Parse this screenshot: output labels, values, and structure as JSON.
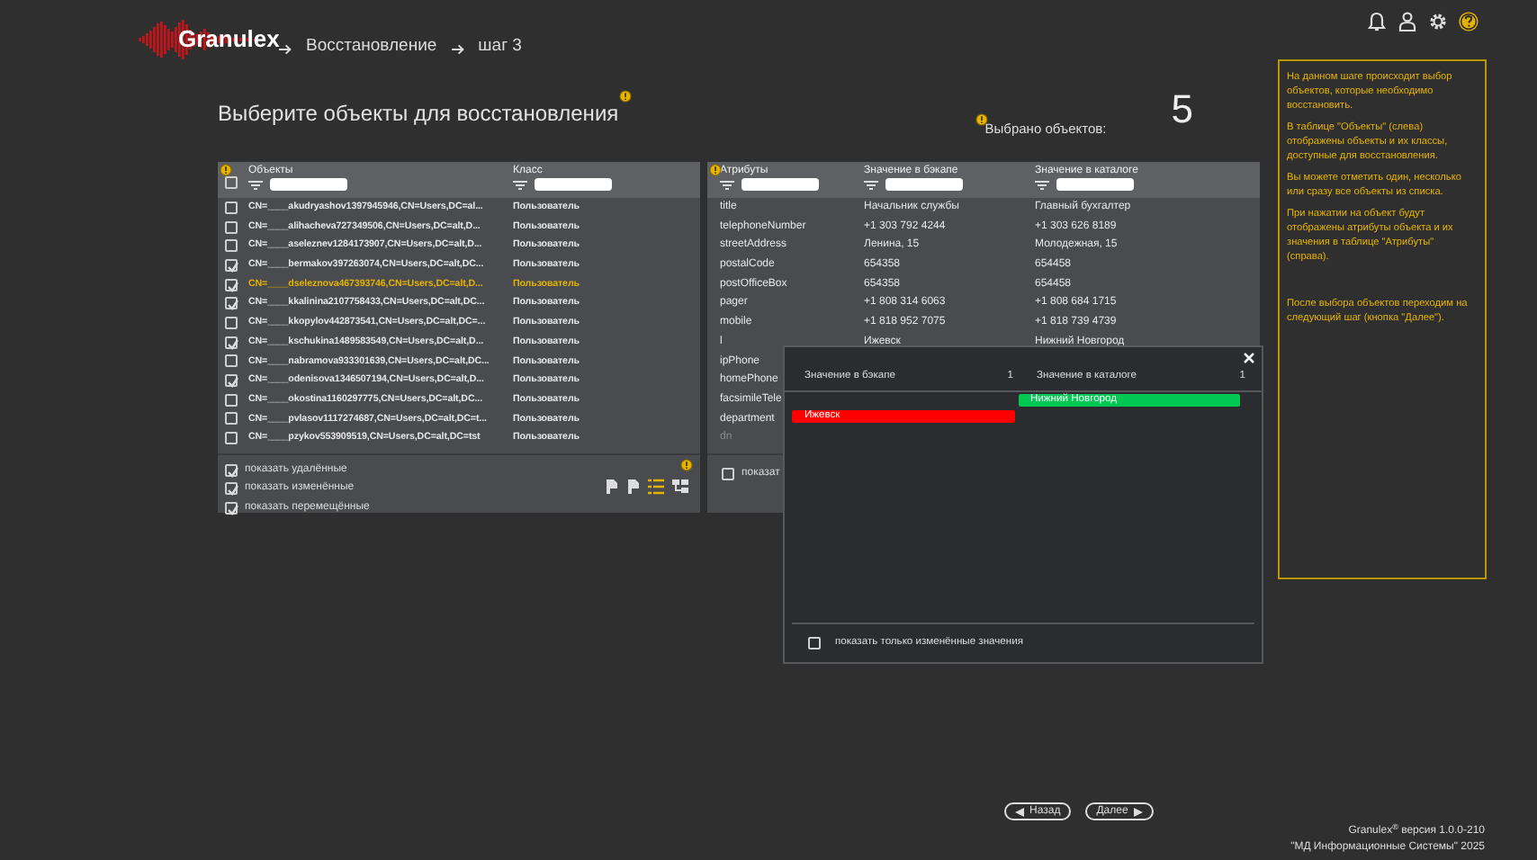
{
  "header": {
    "logo": "Granulex",
    "breadcrumb": [
      "Восстановление",
      "шаг 3"
    ]
  },
  "title": "Выберите объекты для восстановления",
  "selection": {
    "label": "Выбрано объектов:",
    "count": "5"
  },
  "objects": {
    "columns": [
      "Объекты",
      "Класс"
    ],
    "all_checked": false,
    "rows": [
      {
        "name": "CN=____akudryashov1397945946,CN=Users,DC=al...",
        "class": "Пользователь",
        "checked": false,
        "selected": false
      },
      {
        "name": "CN=____alihacheva727349506,CN=Users,DC=alt,D...",
        "class": "Пользователь",
        "checked": false,
        "selected": false
      },
      {
        "name": "CN=____aseleznev1284173907,CN=Users,DC=alt,D...",
        "class": "Пользователь",
        "checked": false,
        "selected": false
      },
      {
        "name": "CN=____bermakov397263074,CN=Users,DC=alt,DC...",
        "class": "Пользователь",
        "checked": true,
        "selected": false
      },
      {
        "name": "CN=____dseleznova467393746,CN=Users,DC=alt,D...",
        "class": "Пользователь",
        "checked": true,
        "selected": true
      },
      {
        "name": "CN=____kkalinina2107758433,CN=Users,DC=alt,DC...",
        "class": "Пользователь",
        "checked": true,
        "selected": false
      },
      {
        "name": "CN=____kkopylov442873541,CN=Users,DC=alt,DC=...",
        "class": "Пользователь",
        "checked": false,
        "selected": false
      },
      {
        "name": "CN=____kschukina1489583549,CN=Users,DC=alt,D...",
        "class": "Пользователь",
        "checked": true,
        "selected": false
      },
      {
        "name": "CN=____nabramova933301639,CN=Users,DC=alt,DC...",
        "class": "Пользователь",
        "checked": false,
        "selected": false
      },
      {
        "name": "CN=____odenisova1346507194,CN=Users,DC=alt,D...",
        "class": "Пользователь",
        "checked": true,
        "selected": false
      },
      {
        "name": "CN=____okostina1160297775,CN=Users,DC=alt,DC...",
        "class": "Пользователь",
        "checked": false,
        "selected": false
      },
      {
        "name": "CN=____pvlasov1117274687,CN=Users,DC=alt,DC=t...",
        "class": "Пользователь",
        "checked": false,
        "selected": false
      },
      {
        "name": "CN=____pzykov553909519,CN=Users,DC=alt,DC=tst",
        "class": "Пользователь",
        "checked": false,
        "selected": false
      }
    ],
    "options": [
      {
        "label": "показать удалённые",
        "checked": true
      },
      {
        "label": "показать изменённые",
        "checked": true
      },
      {
        "label": "показать перемещённые",
        "checked": true
      }
    ]
  },
  "attributes": {
    "columns": [
      "Атрибуты",
      "Значение в бэкапе",
      "Значение в каталоге"
    ],
    "rows": [
      {
        "name": "title",
        "backup": "Начальник службы",
        "catalog": "Главный бухгалтер",
        "dimmed": false
      },
      {
        "name": "telephoneNumber",
        "backup": "+1 303 792 4244",
        "catalog": "+1 303 626 8189",
        "dimmed": false
      },
      {
        "name": "streetAddress",
        "backup": "Ленина, 15",
        "catalog": "Молодежная, 15",
        "dimmed": false
      },
      {
        "name": "postalCode",
        "backup": "654358",
        "catalog": "654458",
        "dimmed": false
      },
      {
        "name": "postOfficeBox",
        "backup": "654358",
        "catalog": "654458",
        "dimmed": false
      },
      {
        "name": "pager",
        "backup": "+1 808 314 6063",
        "catalog": "+1 808 684 1715",
        "dimmed": false
      },
      {
        "name": "mobile",
        "backup": "+1 818 952 7075",
        "catalog": "+1 818 739 4739",
        "dimmed": false
      },
      {
        "name": "l",
        "backup": "Ижевск",
        "catalog": "Нижний Новгород",
        "dimmed": false
      },
      {
        "name": "ipPhone",
        "dimmed": false
      },
      {
        "name": "homePhone",
        "dimmed": false
      },
      {
        "name": "facsimileTele",
        "dimmed": false
      },
      {
        "name": "department",
        "dimmed": false
      },
      {
        "name": "dn",
        "dimmed": true
      }
    ],
    "option": {
      "label": "показат",
      "checked": false
    }
  },
  "compare_dialog": {
    "columns": [
      {
        "label": "Значение в бэкапе",
        "count": "1"
      },
      {
        "label": "Значение в каталоге",
        "count": "1"
      }
    ],
    "rows": [
      {
        "catalog": {
          "text": "Нижний Новгород",
          "color": "#00c853"
        }
      },
      {
        "backup": {
          "text": "Ижевск",
          "color": "#ff0000"
        }
      }
    ],
    "option": {
      "label": "показать только изменённые значения",
      "checked": false
    }
  },
  "help": [
    "На данном шаге происходит выбор объектов, которые необходимо восстановить.",
    "В таблице \"Объекты\" (слева) отображены объекты и их классы, доступные для восстановления.",
    "Вы можете отметить один, несколько или сразу все объекты из списка.",
    "При нажатии на объект будут отображены атрибуты объекта и их значения в таблице \"Атрибуты\" (справа).",
    "После выбора объектов переходим на следующий шаг (кнопка \"Далее\")."
  ],
  "buttons": [
    {
      "label": "Назад",
      "kind": "back"
    },
    {
      "label": "Далее",
      "kind": "next"
    }
  ],
  "footer": [
    "Granulex$^{®}$ версия 1.0.0-210",
    "\"МД Информационные Системы\" 2025"
  ]
}
